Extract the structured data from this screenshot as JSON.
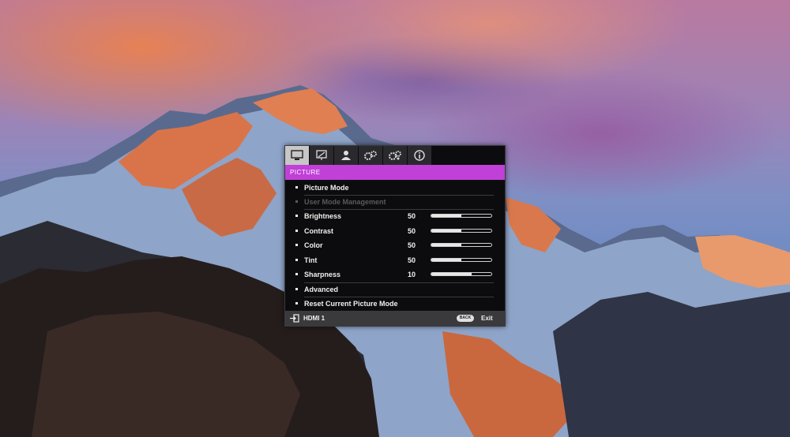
{
  "colors": {
    "accent": "#c040d8",
    "osd_bg": "#0c0c0e",
    "text": "#f0f0f0",
    "disabled": "#5a5a5e"
  },
  "tabs": [
    {
      "icon": "picture-icon",
      "active": true
    },
    {
      "icon": "display-icon",
      "active": false
    },
    {
      "icon": "user-icon",
      "active": false
    },
    {
      "icon": "gears-icon",
      "active": false
    },
    {
      "icon": "settings-gears-icon",
      "active": false
    },
    {
      "icon": "info-icon",
      "active": false
    }
  ],
  "menu": {
    "title": "PICTURE",
    "items": [
      {
        "label": "Picture Mode"
      },
      {
        "label": "User Mode Management",
        "disabled": true
      },
      {
        "label": "Brightness",
        "value": "50",
        "level": 50
      },
      {
        "label": "Contrast",
        "value": "50",
        "level": 50
      },
      {
        "label": "Color",
        "value": "50",
        "level": 50
      },
      {
        "label": "Tint",
        "value": "50",
        "level": 50
      },
      {
        "label": "Sharpness",
        "value": "10",
        "level": 67
      },
      {
        "label": "Advanced"
      },
      {
        "label": "Reset Current Picture Mode"
      }
    ]
  },
  "footer": {
    "source_label": "HDMI 1",
    "back_label": "BACK",
    "exit_label": "Exit"
  }
}
